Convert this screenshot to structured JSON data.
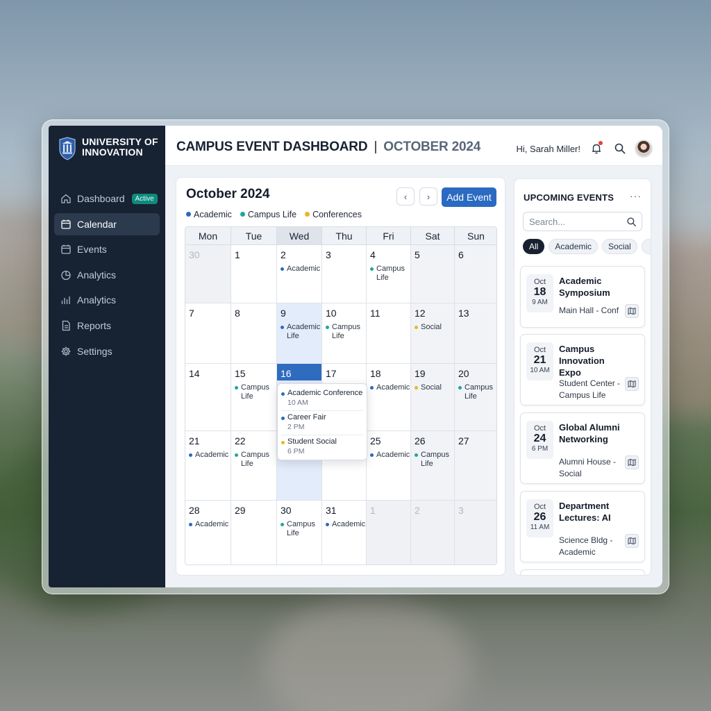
{
  "brand": {
    "name": "UNIVERSITY OF INNOVATION"
  },
  "sidebar": {
    "items": [
      {
        "label": "Dashboard",
        "icon": "home-icon",
        "badge": "Active"
      },
      {
        "label": "Calendar",
        "icon": "calendar-icon",
        "current": true
      },
      {
        "label": "Events",
        "icon": "calendar-event-icon"
      },
      {
        "label": "Analytics",
        "icon": "pie-chart-icon"
      },
      {
        "label": "Analytics",
        "icon": "bar-chart-icon"
      },
      {
        "label": "Reports",
        "icon": "document-icon"
      },
      {
        "label": "Settings",
        "icon": "gear-icon"
      }
    ]
  },
  "header": {
    "title": "CAMPUS EVENT DASHBOARD",
    "separator": "|",
    "subtitle": "OCTOBER 2024",
    "greeting": "Hi, Sarah Miller!"
  },
  "calendar": {
    "month_title": "October 2024",
    "prev_label": "‹",
    "next_label": "›",
    "add_label": "Add Event",
    "legend": [
      {
        "label": "Academic",
        "color": "#2a6ac2"
      },
      {
        "label": "Campus Life",
        "color": "#21a59a"
      },
      {
        "label": "Conferences",
        "color": "#e8b923"
      }
    ],
    "weekdays": [
      "Mon",
      "Tue",
      "Wed",
      "Thu",
      "Fri",
      "Sat",
      "Sun"
    ],
    "weeks": [
      [
        {
          "n": "30",
          "out": true
        },
        {
          "n": "1"
        },
        {
          "n": "2",
          "ev": [
            {
              "t": "Academic",
              "c": "a"
            }
          ]
        },
        {
          "n": "3"
        },
        {
          "n": "4",
          "ev": [
            {
              "t": "Campus Life",
              "c": "c"
            }
          ]
        },
        {
          "n": "5"
        },
        {
          "n": "6"
        }
      ],
      [
        {
          "n": "7"
        },
        {
          "n": "8"
        },
        {
          "n": "9",
          "hl": true,
          "ev": [
            {
              "t": "Academic Life",
              "c": "a"
            }
          ]
        },
        {
          "n": "10",
          "ev": [
            {
              "t": "Campus Life",
              "c": "c"
            }
          ]
        },
        {
          "n": "11"
        },
        {
          "n": "12",
          "ev": [
            {
              "t": "Social",
              "c": "y"
            }
          ]
        },
        {
          "n": "13"
        }
      ],
      [
        {
          "n": "14"
        },
        {
          "n": "15",
          "ev": [
            {
              "t": "Campus Life",
              "c": "c"
            }
          ]
        },
        {
          "n": "16",
          "today": true
        },
        {
          "n": "17"
        },
        {
          "n": "18",
          "ev": [
            {
              "t": "Academic",
              "c": "a"
            }
          ]
        },
        {
          "n": "19",
          "ev": [
            {
              "t": "Social",
              "c": "y"
            }
          ]
        },
        {
          "n": "20",
          "ev": [
            {
              "t": "Campus Life",
              "c": "c"
            }
          ]
        }
      ],
      [
        {
          "n": "21",
          "ev": [
            {
              "t": "Academic",
              "c": "a"
            }
          ]
        },
        {
          "n": "22",
          "ev": [
            {
              "t": "Campus Life",
              "c": "c"
            }
          ]
        },
        {
          "n": "",
          "hl": true
        },
        {
          "n": ""
        },
        {
          "n": "25",
          "ev": [
            {
              "t": "Academic",
              "c": "a"
            }
          ]
        },
        {
          "n": "26",
          "ev": [
            {
              "t": "Campus Life",
              "c": "c"
            }
          ]
        },
        {
          "n": "27"
        }
      ],
      [
        {
          "n": "28",
          "ev": [
            {
              "t": "Academic",
              "c": "a"
            }
          ]
        },
        {
          "n": "29"
        },
        {
          "n": "30",
          "ev": [
            {
              "t": "Campus Life",
              "c": "c"
            }
          ]
        },
        {
          "n": "31",
          "ev": [
            {
              "t": "Academic",
              "c": "a"
            }
          ]
        },
        {
          "n": "1",
          "out": true
        },
        {
          "n": "2",
          "out": true
        },
        {
          "n": "3",
          "out": true
        }
      ]
    ],
    "popover": [
      {
        "title": "Academic Conference",
        "time": "10 AM",
        "c": "a"
      },
      {
        "title": "Career Fair",
        "time": "2 PM",
        "c": "a"
      },
      {
        "title": "Student Social",
        "time": "6 PM",
        "c": "y"
      }
    ]
  },
  "upcoming": {
    "title": "UPCOMING EVENTS",
    "more": "···",
    "search_placeholder": "Search...",
    "chips": [
      "All",
      "Academic",
      "Social"
    ],
    "events": [
      {
        "month": "Oct",
        "day": "18",
        "time": "9 AM",
        "name": "Academic Symposium",
        "location": "Main Hall - Conf"
      },
      {
        "month": "Oct",
        "day": "21",
        "time": "10 AM",
        "name": "Campus Innovation Expo",
        "location": "Student Center - Campus Life"
      },
      {
        "month": "Oct",
        "day": "24",
        "time": "6 PM",
        "name": "Global Alumni Networking",
        "location": "Alumni House - Social"
      },
      {
        "month": "Oct",
        "day": "26",
        "time": "11 AM",
        "name": "Department Lectures: AI",
        "location": "Science Bldg - Academic"
      }
    ]
  },
  "colors": {
    "academic": "#2a6ac2",
    "campus": "#21a59a",
    "social": "#e8b923",
    "sidebar": "#172233",
    "accent": "#2a6ac2"
  }
}
